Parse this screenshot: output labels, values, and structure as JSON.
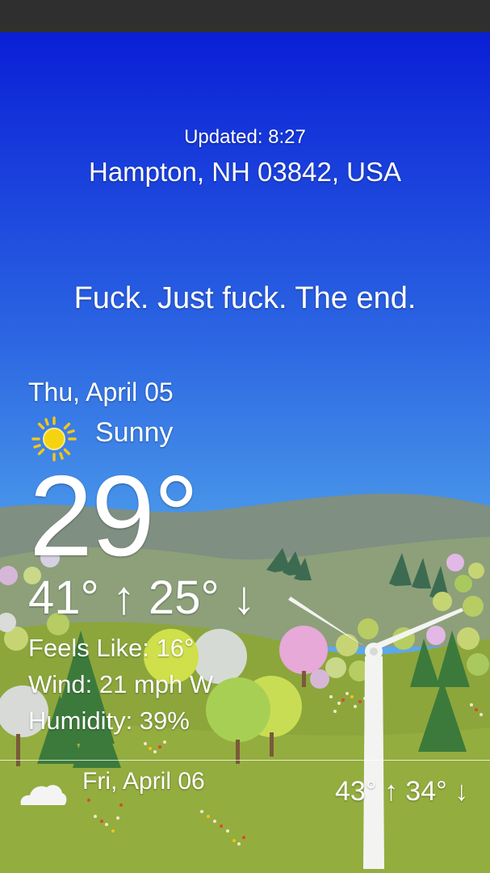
{
  "header": {
    "updated": "Updated: 8:27",
    "location": "Hampton, NH 03842, USA"
  },
  "headline": "Fuck. Just fuck. The end.",
  "current": {
    "date": "Thu, April 05",
    "condition": "Sunny",
    "condition_icon": "sun-icon",
    "temperature": "29°",
    "hi_lo": "41° ↑ 25° ↓",
    "feels_like": "Feels Like: 16°",
    "wind": "Wind: 21 mph W",
    "humidity": "Humidity: 39%"
  },
  "forecast": [
    {
      "day": "Fri, April 06",
      "icon": "cloud-icon",
      "hi_lo": "43° ↑ 34° ↓"
    }
  ],
  "colors": {
    "sky_top": "#0a1fd6",
    "sky_bottom": "#5fb0ee",
    "hills": "#7c8f6f",
    "meadow": "#8fa83e",
    "sun": "#f5c518"
  }
}
